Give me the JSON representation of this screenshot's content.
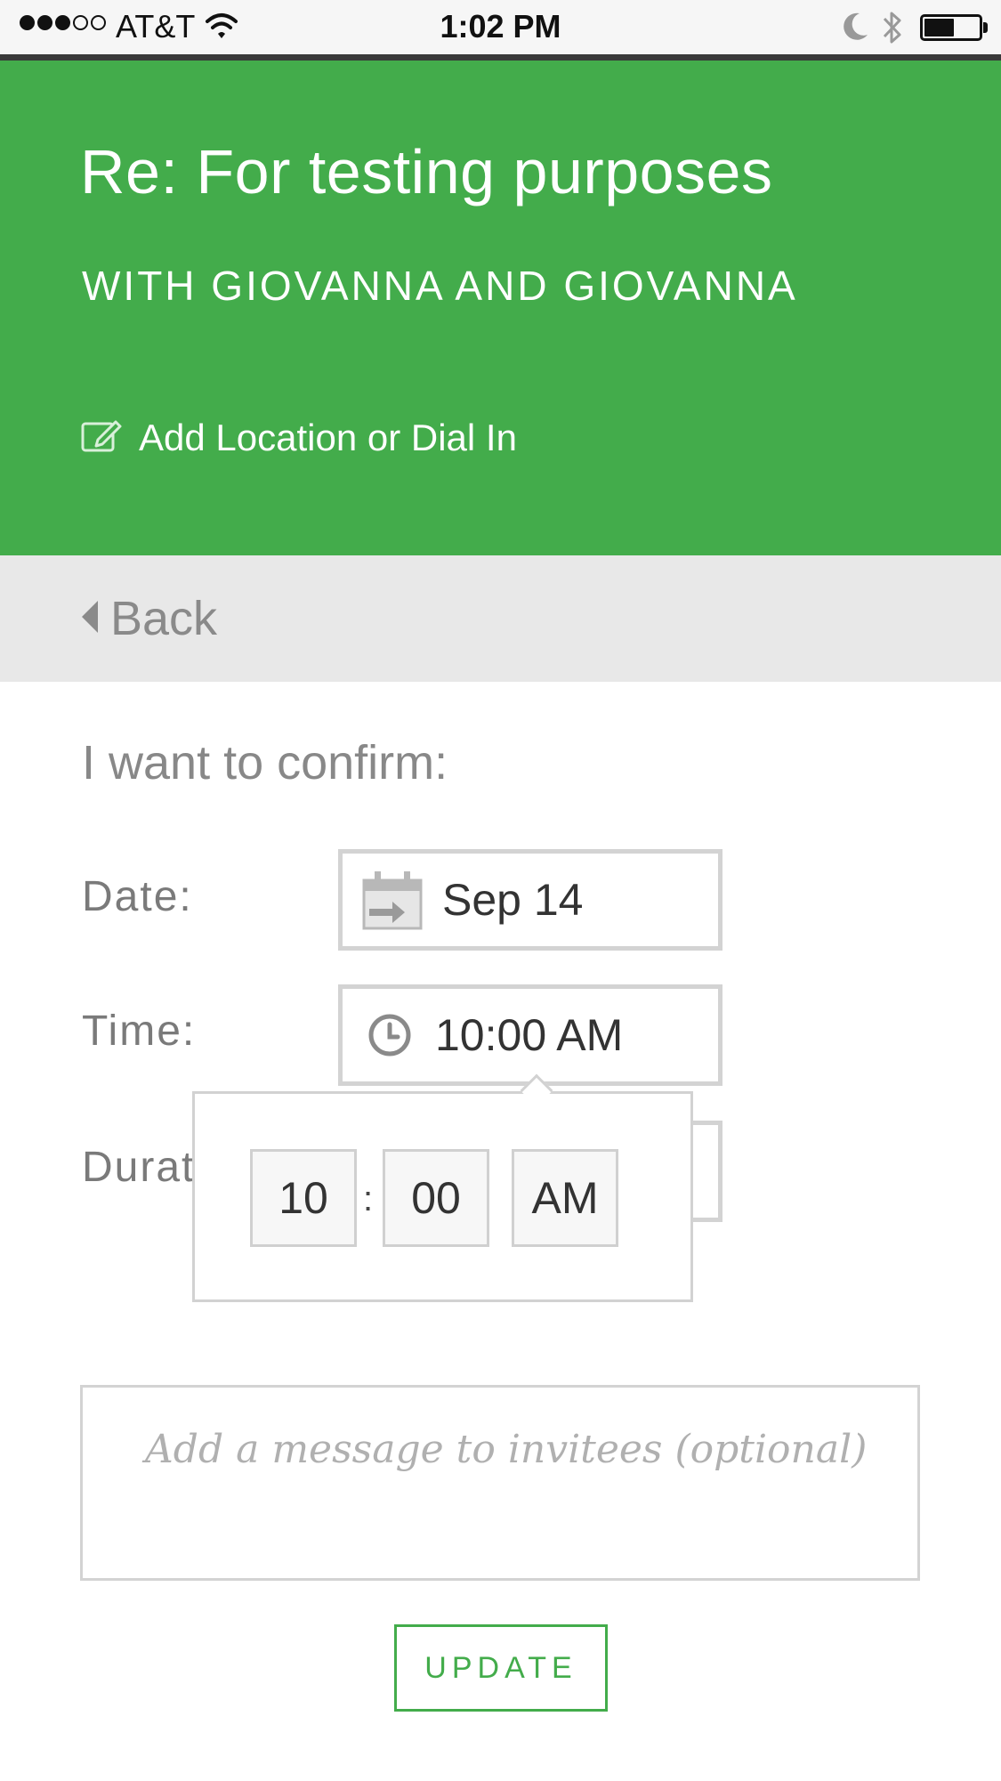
{
  "status_bar": {
    "carrier": "AT&T",
    "time": "1:02 PM",
    "signal_bars": 3,
    "signal_total": 5,
    "battery_level": 0.55
  },
  "header": {
    "title": "Re: For testing purposes",
    "subtitle": "WITH GIOVANNA AND GIOVANNA",
    "add_location": "Add Location or Dial In",
    "background_color": "#43ac4b"
  },
  "nav": {
    "back_label": "Back"
  },
  "form": {
    "heading": "I want to confirm:",
    "date_label": "Date:",
    "date_value": "Sep 14",
    "time_label": "Time:",
    "time_value": "10:00 AM",
    "duration_label_visible": "Durat"
  },
  "time_picker": {
    "hour": "10",
    "separator": ":",
    "minute": "00",
    "period": "AM"
  },
  "message": {
    "placeholder": "Add a message to invitees (optional)"
  },
  "actions": {
    "update_label": "UPDATE",
    "accent_color": "#43ac4b"
  }
}
